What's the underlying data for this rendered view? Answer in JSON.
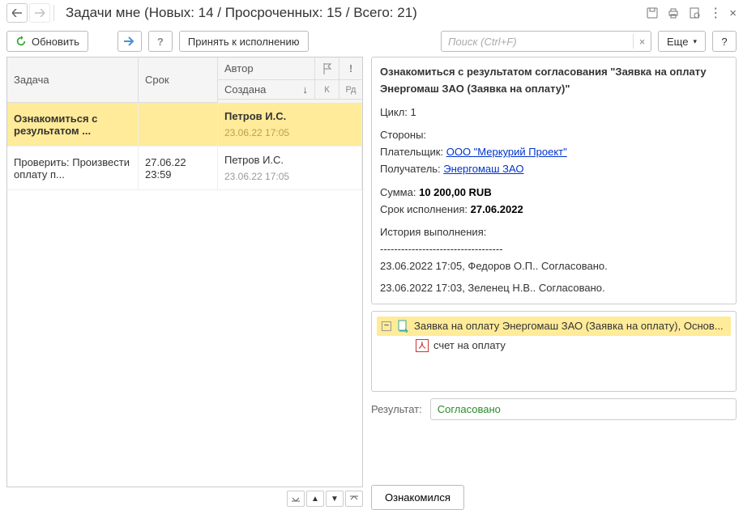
{
  "title": "Задачи мне (Новых: 14 / Просроченных: 15 / Всего: 21)",
  "toolbar": {
    "refresh": "Обновить",
    "accept": "Принять к исполнению",
    "more": "Еще",
    "help": "?"
  },
  "search": {
    "placeholder": "Поиск (Ctrl+F)"
  },
  "columns": {
    "task": "Задача",
    "date": "Срок",
    "author": "Автор",
    "created": "Создана",
    "k": "К",
    "rd": "Рд"
  },
  "rows": [
    {
      "task": "Ознакомиться с результатом ...",
      "date": "",
      "author": "Петров И.С.",
      "created": "23.06.22 17:05",
      "selected": true
    },
    {
      "task": "Проверить: Произвести оплату п...",
      "date": "27.06.22 23:59",
      "author": "Петров И.С.",
      "created": "23.06.22 17:05",
      "selected": false
    }
  ],
  "detail": {
    "title": "Ознакомиться с результатом согласования \"Заявка на оплату Энергомаш ЗАО (Заявка на оплату)\"",
    "cycle_label": "Цикл:",
    "cycle": "1",
    "parties_label": "Стороны:",
    "payer_label": "Плательщик:",
    "payer": "ООО \"Меркурий Проект\"",
    "recipient_label": "Получатель:",
    "recipient": "Энергомаш ЗАО",
    "sum_label": "Сумма:",
    "sum": "10 200,00 RUB",
    "due_label": "Срок исполнения:",
    "due": "27.06.2022",
    "history_label": "История выполнения:",
    "history_sep": "-----------------------------------",
    "history1": "23.06.2022 17:05, Федоров О.П.. Согласовано.",
    "history2": "23.06.2022 17:03, Зеленец Н.В.. Согласовано."
  },
  "tree": {
    "root": "Заявка на оплату Энергомаш ЗАО (Заявка на оплату), Основ...",
    "child": "счет на оплату"
  },
  "result": {
    "label": "Результат:",
    "value": "Согласовано"
  },
  "actions": {
    "ack": "Ознакомился"
  }
}
